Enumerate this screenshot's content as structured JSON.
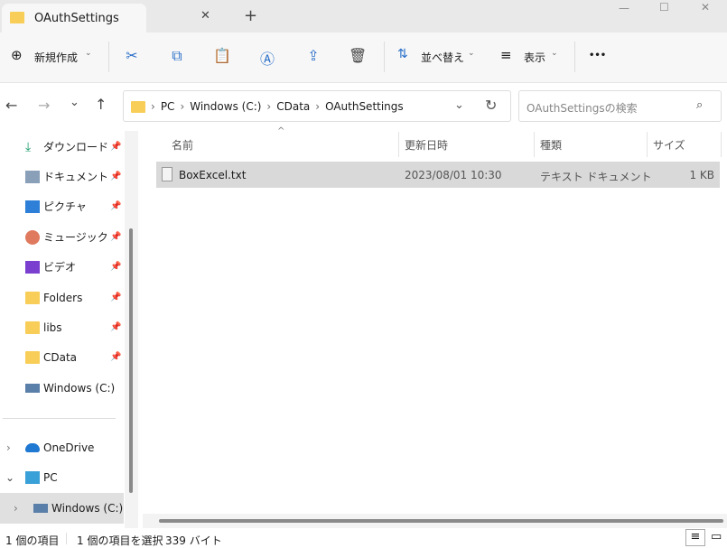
{
  "window": {
    "tab_title": "OAuthSettings",
    "new_tab": "+",
    "minimize": "—",
    "maximize": "☐",
    "close": "✕"
  },
  "toolbar": {
    "new_label": "新規作成",
    "sort_label": "並べ替え",
    "view_label": "表示",
    "more": "•••"
  },
  "address": {
    "crumbs": [
      "PC",
      "Windows (C:)",
      "CData",
      "OAuthSettings"
    ],
    "search_placeholder": "OAuthSettingsの検索"
  },
  "sidebar": {
    "quick": [
      {
        "label": "ダウンロード",
        "icon": "download-icon"
      },
      {
        "label": "ドキュメント",
        "icon": "document-icon"
      },
      {
        "label": "ピクチャ",
        "icon": "pictures-icon"
      },
      {
        "label": "ミュージック",
        "icon": "music-icon"
      },
      {
        "label": "ビデオ",
        "icon": "video-icon"
      },
      {
        "label": "Folders",
        "icon": "folder-icon"
      },
      {
        "label": "libs",
        "icon": "folder-icon"
      },
      {
        "label": "CData",
        "icon": "folder-icon"
      },
      {
        "label": "Windows (C:)",
        "icon": "drive-icon"
      }
    ],
    "tree": [
      {
        "label": "OneDrive"
      },
      {
        "label": "PC"
      },
      {
        "label": "Windows (C:)"
      }
    ]
  },
  "columns": {
    "name": "名前",
    "modified": "更新日時",
    "type": "種類",
    "size": "サイズ"
  },
  "files": [
    {
      "name": "BoxExcel.txt",
      "modified": "2023/08/01 10:30",
      "type": "テキスト ドキュメント",
      "size": "1 KB"
    }
  ],
  "status": {
    "count": "1 個の項目",
    "selected": "1 個の項目を選択",
    "bytes": "339 バイト"
  }
}
